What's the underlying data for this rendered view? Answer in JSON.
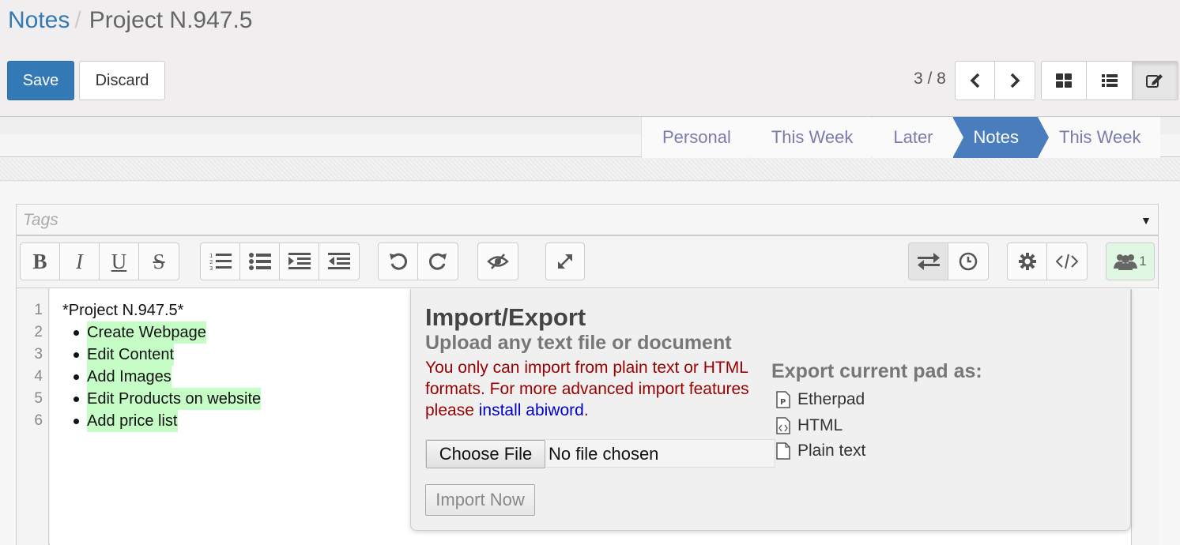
{
  "breadcrumb": {
    "parent": "Notes",
    "separator": "/",
    "current": "Project N.947.5"
  },
  "actions": {
    "save": "Save",
    "discard": "Discard"
  },
  "pager": {
    "value": "3 / 8"
  },
  "stages": [
    {
      "label": "Personal",
      "active": false
    },
    {
      "label": "This Week",
      "active": false
    },
    {
      "label": "Later",
      "active": false
    },
    {
      "label": "Notes",
      "active": true
    },
    {
      "label": "This Week",
      "active": false
    }
  ],
  "tags": {
    "placeholder": "Tags"
  },
  "toolbar": {
    "users_count": "1"
  },
  "editor": {
    "line_numbers": [
      "1",
      "2",
      "3",
      "4",
      "5",
      "6"
    ],
    "title_line": "*Project N.947.5*",
    "items": [
      "Create Webpage",
      "Edit Content",
      "Add Images",
      "Edit Products on website",
      "Add price list"
    ]
  },
  "import_export": {
    "title": "Import/Export",
    "subtitle": "Upload any text file or document",
    "warning": "You only can import from plain text or HTML formats. For more advanced import features please",
    "warning_link": "install abiword",
    "warning_end": ".",
    "choose_file": "Choose File",
    "no_file": "No file chosen",
    "import_now": "Import Now",
    "export_heading": "Export current pad as:",
    "export_options": [
      "Etherpad",
      "HTML",
      "Plain text"
    ]
  },
  "colors": {
    "primary": "#337ab7",
    "active_stage": "#4a7dbd",
    "stage_text": "#7c7bad",
    "highlight": "#c6fdc6",
    "warning": "#990000"
  }
}
